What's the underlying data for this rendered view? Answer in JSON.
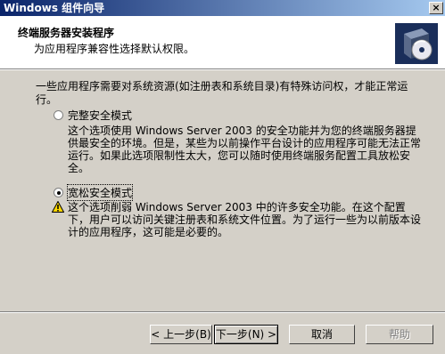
{
  "window": {
    "title": "Windows 组件向导",
    "close_label": "×"
  },
  "header": {
    "title": "终端服务器安装程序",
    "subtitle": "为应用程序兼容性选择默认权限。",
    "icon": "setup-box-cd-icon"
  },
  "intro": "一些应用程序需要对系统资源(如注册表和系统目录)有特殊访问权，才能正常运行。",
  "options": [
    {
      "label": "完整安全模式",
      "selected": false,
      "description": "这个选项使用 Windows Server 2003 的安全功能并为您的终端服务器提供最安全的环境。但是，某些为以前操作平台设计的应用程序可能无法正常运行。如果此选项限制性太大，您可以随时使用终端服务配置工具放松安全。"
    },
    {
      "label": "宽松安全模式",
      "selected": true,
      "description": "这个选项削弱 Windows Server 2003 中的许多安全功能。在这个配置下，用户可以访问关键注册表和系统文件位置。为了运行一些为以前版本设计的应用程序，这可能是必要的。",
      "warning_icon": "warning-icon"
    }
  ],
  "buttons": {
    "back": "< 上一步(B)",
    "next": "下一步(N) >",
    "cancel": "取消",
    "help": "帮助"
  }
}
